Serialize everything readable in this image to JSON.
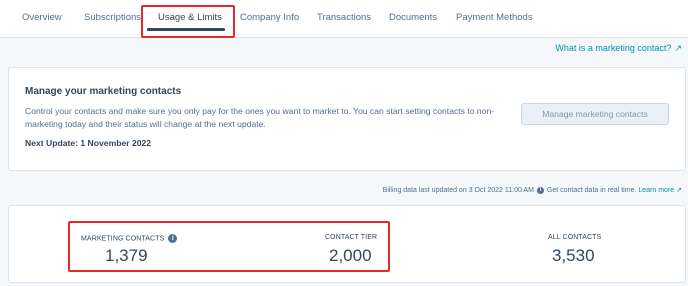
{
  "tabs": [
    {
      "label": "Overview"
    },
    {
      "label": "Subscriptions"
    },
    {
      "label": "Usage & Limits"
    },
    {
      "label": "Company Info"
    },
    {
      "label": "Transactions"
    },
    {
      "label": "Documents"
    },
    {
      "label": "Payment Methods"
    }
  ],
  "active_tab": "Usage & Limits",
  "help_link": "What is a marketing contact?",
  "manage_card": {
    "title": "Manage your marketing contacts",
    "description": "Control your contacts and make sure you only pay for the ones you want to market to. You can start setting contacts to non-marketing today and their status will change at the next update.",
    "next_update": "Next Update: 1 November 2022",
    "button_label": "Manage marketing contacts"
  },
  "billing": {
    "text": "Billing data last updated on 3 Oct 2022 11:00 AM",
    "realtime_text": "Get contact data in real time.",
    "learn_more": "Learn more"
  },
  "stats": [
    {
      "label": "MARKETING CONTACTS",
      "value": "1,379"
    },
    {
      "label": "CONTACT TIER",
      "value": "2,000"
    },
    {
      "label": "ALL CONTACTS",
      "value": "3,530"
    }
  ],
  "colors": {
    "link": "#0091ae",
    "highlight": "#e8262d",
    "text": "#33475b"
  }
}
